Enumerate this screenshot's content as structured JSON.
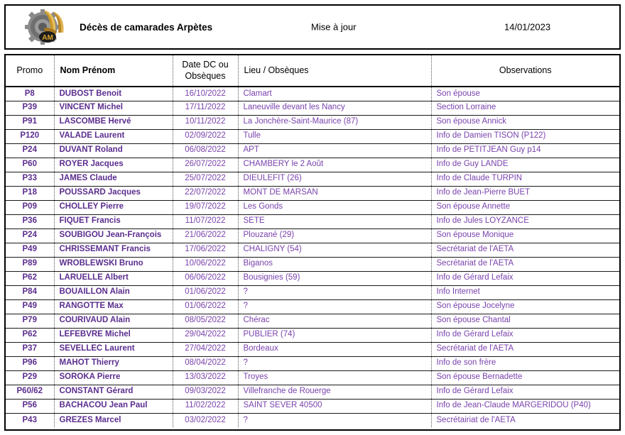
{
  "document": {
    "title": "Décès de camarades Arpètes",
    "update_label": "Mise à jour",
    "update_date": "14/01/2023",
    "logo_text": "AM",
    "logo_name": "gear-wings-am-logo",
    "text_color": "#7a42ad",
    "name_color": "#5b2d8e",
    "border_color": "#000000"
  },
  "table": {
    "headers": {
      "promo": "Promo",
      "nom": "Nom Prénom",
      "date": "Date DC ou Obsèques",
      "date_line1": "Date DC ou",
      "date_line2": "Obsèques",
      "lieu": "Lieu / Obsèques",
      "observations": "Observations"
    },
    "rows": [
      {
        "promo": "P8",
        "nom": "DUBOST Benoit",
        "date": "16/10/2022",
        "lieu": "Clamart",
        "obs": "Son épouse"
      },
      {
        "promo": "P39",
        "nom": "VINCENT Michel",
        "date": "17/11/2022",
        "lieu": "Laneuville devant les Nancy",
        "obs": "Section Lorraine"
      },
      {
        "promo": "P91",
        "nom": "LASCOMBE Hervé",
        "date": "10/11/2022",
        "lieu": "La Jonchère-Saint-Maurice (87)",
        "obs": "Son épouse Annick"
      },
      {
        "promo": "P120",
        "nom": "VALADE Laurent",
        "date": "02/09/2022",
        "lieu": "Tulle",
        "obs": "Info de Damien TISON (P122)"
      },
      {
        "promo": "P24",
        "nom": "DUVANT Roland",
        "date": "06/08/2022",
        "lieu": "APT",
        "obs": "Info de PETITJEAN Guy p14"
      },
      {
        "promo": "P60",
        "nom": "ROYER Jacques",
        "date": "26/07/2022",
        "lieu": "CHAMBERY le 2 Août",
        "obs": "Info de Guy LANDE"
      },
      {
        "promo": "P33",
        "nom": "JAMES Claude",
        "date": "25/07/2022",
        "lieu": "DIEULEFIT (26)",
        "obs": "Info de Claude TURPIN"
      },
      {
        "promo": "P18",
        "nom": "POUSSARD Jacques",
        "date": "22/07/2022",
        "lieu": "MONT DE MARSAN",
        "obs": "Info de Jean-Pierre BUET"
      },
      {
        "promo": "P09",
        "nom": "CHOLLEY Pierre",
        "date": "19/07/2022",
        "lieu": "Les Gonds",
        "obs": "Son épouse Annette"
      },
      {
        "promo": "P36",
        "nom": "FIQUET Francis",
        "date": "11/07/2022",
        "lieu": "SETE",
        "obs": "Info de Jules LOYZANCE"
      },
      {
        "promo": "P24",
        "nom": "SOUBIGOU Jean-François",
        "date": "21/06/2022",
        "lieu": "Plouzané (29)",
        "obs": "Son épouse Monique"
      },
      {
        "promo": "P49",
        "nom": "CHRISSEMANT Francis",
        "date": "17/06/2022",
        "lieu": "CHALIGNY (54)",
        "obs": "Secrétariat de l'AETA"
      },
      {
        "promo": "P89",
        "nom": "WROBLEWSKI Bruno",
        "date": "10/06/2022",
        "lieu": "Biganos",
        "obs": "Secrétariat de l'AETA"
      },
      {
        "promo": "P62",
        "nom": "LARUELLE Albert",
        "date": "06/06/2022",
        "lieu": "Bousignies (59)",
        "obs": "Info de Gérard Lefaix"
      },
      {
        "promo": "P84",
        "nom": "BOUAILLON Alain",
        "date": "01/06/2022",
        "lieu": "?",
        "obs": "Info Internet"
      },
      {
        "promo": "P49",
        "nom": "RANGOTTE Max",
        "date": "01/06/2022",
        "lieu": "?",
        "obs": "Son épouse Jocelyne"
      },
      {
        "promo": "P79",
        "nom": "COURIVAUD Alain",
        "date": "08/05/2022",
        "lieu": "Chérac",
        "obs": "Son épouse Chantal"
      },
      {
        "promo": "P62",
        "nom": "LEFEBVRE Michel",
        "date": "29/04/2022",
        "lieu": "PUBLIER (74)",
        "obs": "Info de Gérard Lefaix"
      },
      {
        "promo": "P37",
        "nom": "SEVELLEC Laurent",
        "date": "27/04/2022",
        "lieu": "Bordeaux",
        "obs": "Secrétariat de l'AETA"
      },
      {
        "promo": "P96",
        "nom": "MAHOT Thierry",
        "date": "08/04/2022",
        "lieu": "?",
        "obs": "Info de son frère"
      },
      {
        "promo": "P29",
        "nom": "SOROKA Pierre",
        "date": "13/03/2022",
        "lieu": "Troyes",
        "obs": "Son épouse Bernadette"
      },
      {
        "promo": "P60/62",
        "nom": "CONSTANT Gérard",
        "date": "09/03/2022",
        "lieu": "Villefranche de Rouerge",
        "obs": "Info de Gérard Lefaix"
      },
      {
        "promo": "P56",
        "nom": "BACHACOU Jean Paul",
        "date": "11/02/2022",
        "lieu": "SAINT SEVER 40500",
        "obs": "Info de Jean-Claude MARGERIDOU (P40)"
      },
      {
        "promo": "P43",
        "nom": "GREZES Marcel",
        "date": "03/02/2022",
        "lieu": "?",
        "obs": "Secrétairiat de l'AETA"
      }
    ]
  }
}
